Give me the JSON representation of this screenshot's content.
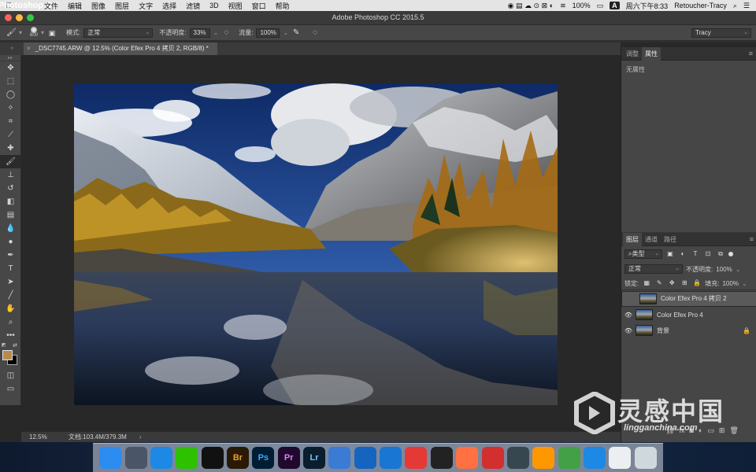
{
  "menubar": {
    "app_name": "Photoshop CC",
    "items": [
      "文件",
      "编辑",
      "图像",
      "图层",
      "文字",
      "选择",
      "滤镜",
      "3D",
      "视图",
      "窗口",
      "帮助"
    ],
    "battery": "100%",
    "input_method": "A",
    "clock": "周六下午8:33",
    "user": "Retoucher-Tracy"
  },
  "window": {
    "title": "Adobe Photoshop CC 2015.5"
  },
  "options_bar": {
    "brush_size": "600",
    "mode_label": "模式:",
    "mode_value": "正常",
    "opacity_label": "不透明度:",
    "opacity_value": "33%",
    "flow_label": "流量:",
    "flow_value": "100%",
    "workspace": "Tracy"
  },
  "document": {
    "tab_label": "_DSC7745.ARW @ 12.5% (Color Efex Pro 4 拷贝 2, RGB/8) *",
    "zoom": "12.5%",
    "doc_size": "文档:103.4M/379.3M"
  },
  "panel_top": {
    "tabs": [
      "调整",
      "属性"
    ],
    "active": 1,
    "empty_text": "无属性"
  },
  "layers_panel": {
    "tabs": [
      "图层",
      "通道",
      "路径"
    ],
    "filter_label": "类型",
    "blend_mode": "正常",
    "opacity_label": "不透明度:",
    "opacity_value": "100%",
    "lock_label": "锁定:",
    "fill_label": "填充:",
    "fill_value": "100%",
    "layers": [
      {
        "name": "Color Efex Pro 4 拷贝 2",
        "selected": true,
        "visible": false
      },
      {
        "name": "Color Efex Pro 4",
        "selected": false,
        "visible": true
      },
      {
        "name": "背景",
        "selected": false,
        "visible": true,
        "locked": true
      }
    ]
  },
  "dock": {
    "apps": [
      {
        "name": "finder",
        "label": "",
        "color": "#2d8cf0"
      },
      {
        "name": "launchpad",
        "label": "",
        "color": "#4a5568"
      },
      {
        "name": "safari",
        "label": "",
        "color": "#1e88e5"
      },
      {
        "name": "wechat",
        "label": "",
        "color": "#2dc100"
      },
      {
        "name": "qq",
        "label": "",
        "color": "#111111"
      },
      {
        "name": "bridge",
        "label": "Br",
        "color": "#2a1a05"
      },
      {
        "name": "photoshop",
        "label": "Ps",
        "color": "#001d34"
      },
      {
        "name": "premiere",
        "label": "Pr",
        "color": "#1f0a2e"
      },
      {
        "name": "lightroom",
        "label": "Lr",
        "color": "#0a1e2e"
      },
      {
        "name": "baidu-netdisk",
        "label": "",
        "color": "#3a7bd5"
      },
      {
        "name": "video-app",
        "label": "",
        "color": "#1565c0"
      },
      {
        "name": "onepassword",
        "label": "",
        "color": "#1976d2"
      },
      {
        "name": "video-player",
        "label": "",
        "color": "#e53935"
      },
      {
        "name": "obs",
        "label": "",
        "color": "#222222"
      },
      {
        "name": "xunlei",
        "label": "",
        "color": "#ff7043"
      },
      {
        "name": "netease-music",
        "label": "",
        "color": "#d32f2f"
      },
      {
        "name": "quicktime",
        "label": "",
        "color": "#37474f"
      },
      {
        "name": "pages",
        "label": "",
        "color": "#ff9800"
      },
      {
        "name": "numbers",
        "label": "",
        "color": "#43a047"
      },
      {
        "name": "keynote",
        "label": "",
        "color": "#1e88e5"
      },
      {
        "name": "screenshot",
        "label": "",
        "color": "#eceff1"
      },
      {
        "name": "trash",
        "label": "",
        "color": "#cfd8dc"
      }
    ]
  },
  "watermark": {
    "cn": "灵感中国",
    "en": "lingganchina.com"
  }
}
